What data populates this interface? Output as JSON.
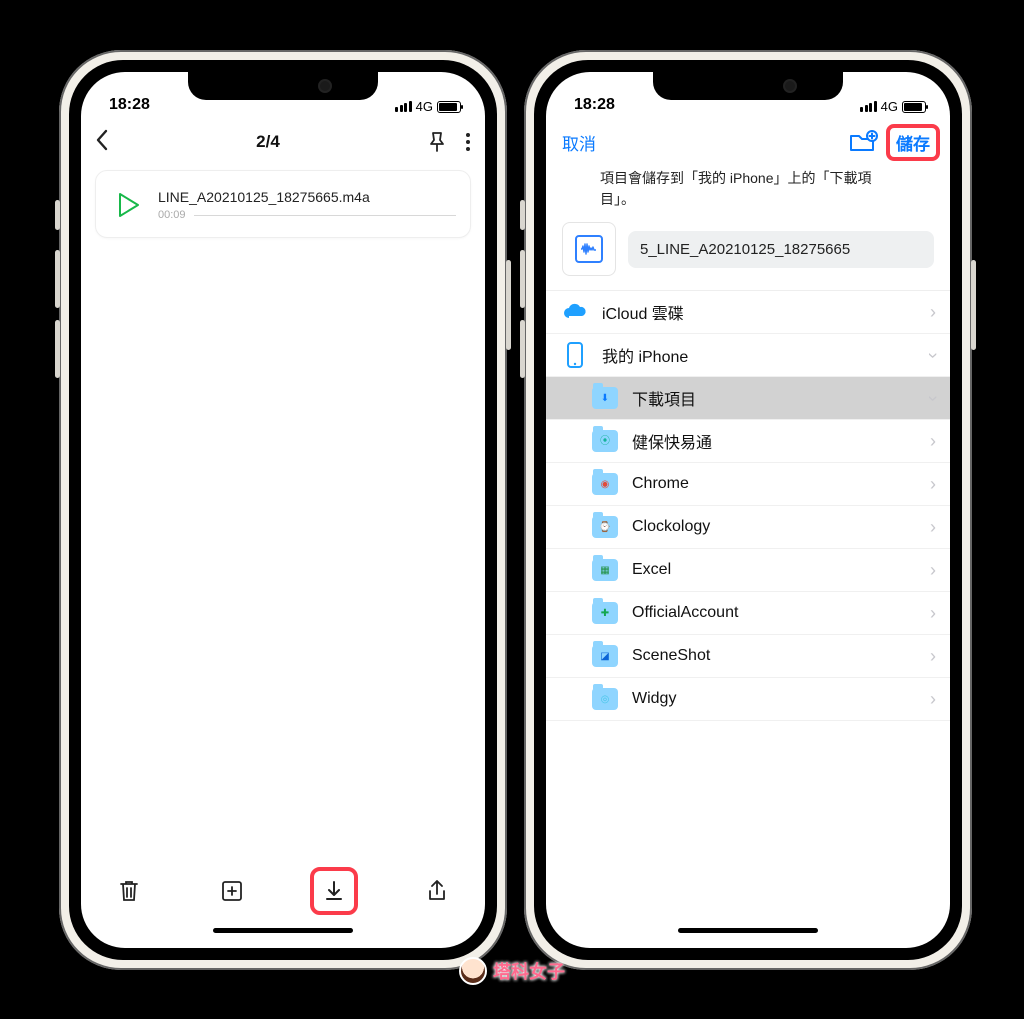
{
  "status": {
    "time": "18:28",
    "net": "4G"
  },
  "left": {
    "counter": "2/4",
    "file": {
      "name": "LINE_A20210125_18275665.m4a",
      "duration": "00:09"
    }
  },
  "right": {
    "cancel": "取消",
    "save": "儲存",
    "hint": "項目會儲存到「我的 iPhone」上的「下載項目」。",
    "filename": "5_LINE_A20210125_18275665",
    "locations": {
      "icloud": "iCloud 雲碟",
      "iphone": "我的 iPhone"
    },
    "folders": [
      {
        "label": "下載項目",
        "selected": true,
        "badge": "⬇"
      },
      {
        "label": "健保快易通",
        "badge": "⦿",
        "color": "#17b39b"
      },
      {
        "label": "Chrome",
        "badge": "◉",
        "color": "#e14b3a"
      },
      {
        "label": "Clockology",
        "badge": "⌚",
        "color": "#111"
      },
      {
        "label": "Excel",
        "badge": "▦",
        "color": "#1e8e3e"
      },
      {
        "label": "OfficialAccount",
        "badge": "✚",
        "color": "#13a650"
      },
      {
        "label": "SceneShot",
        "badge": "◪",
        "color": "#0b63d6"
      },
      {
        "label": "Widgy",
        "badge": "◎",
        "color": "#46c6e8"
      }
    ]
  },
  "watermark": "塔科女子"
}
